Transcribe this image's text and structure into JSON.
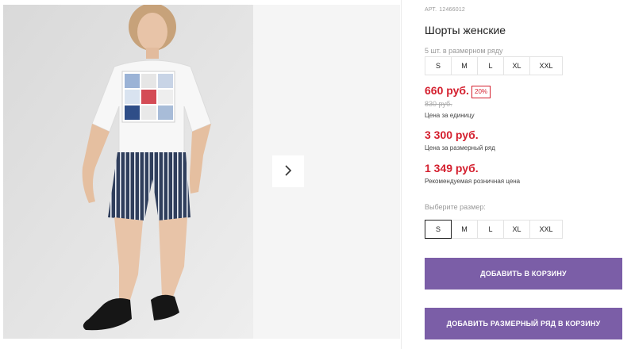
{
  "gallery": {
    "next_icon": "chevron-right-icon"
  },
  "product": {
    "article_label": "АРТ.",
    "article_number": "12466012",
    "title": "Шорты женские",
    "pack_label": "5 шт. в размерном ряду",
    "pack_sizes": [
      "S",
      "M",
      "L",
      "XL",
      "XXL"
    ],
    "price": "660 руб.",
    "discount": "20%",
    "old_price": "830 руб.",
    "price_caption": "Цена за единицу",
    "pack_price": "3 300 руб.",
    "pack_price_caption": "Цена за размерный ряд",
    "rrp_price": "1 349 руб.",
    "rrp_caption": "Рекомендуемая розничная цена",
    "choose_size_label": "Выберите размер:",
    "choose_sizes": [
      "S",
      "M",
      "L",
      "XL",
      "XXL"
    ],
    "selected_size": "S",
    "add_to_cart": "ДОБАВИТЬ В КОРЗИНУ",
    "add_pack_to_cart": "ДОБАВИТЬ РАЗМЕРНЫЙ РЯД В КОРЗИНУ"
  },
  "colors": {
    "accent": "#7b5ea7",
    "price_red": "#d41f2e"
  }
}
